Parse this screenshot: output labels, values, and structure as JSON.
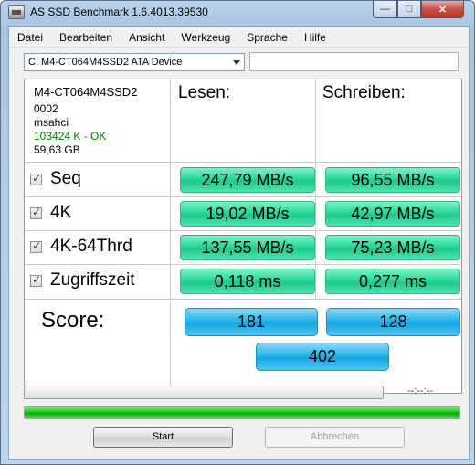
{
  "window": {
    "title": "AS SSD Benchmark 1.6.4013.39530"
  },
  "menu": [
    "Datei",
    "Bearbeiten",
    "Ansicht",
    "Werkzeug",
    "Sprache",
    "Hilfe"
  ],
  "drive_select": {
    "value": "C: M4-CT064M4SSD2 ATA Device"
  },
  "device_info": {
    "name": "M4-CT064M4SSD2",
    "firmware": "0002",
    "driver": "msahci",
    "alignment": "103424 K - OK",
    "size": "59,63 GB"
  },
  "columns": {
    "read": "Lesen:",
    "write": "Schreiben:"
  },
  "rows": [
    {
      "label": "Seq",
      "read": "247,79 MB/s",
      "write": "96,55 MB/s"
    },
    {
      "label": "4K",
      "read": "19,02 MB/s",
      "write": "42,97 MB/s"
    },
    {
      "label": "4K-64Thrd",
      "read": "137,55 MB/s",
      "write": "75,23 MB/s"
    },
    {
      "label": "Zugriffszeit",
      "read": "0,118 ms",
      "write": "0,277 ms"
    }
  ],
  "score": {
    "label": "Score:",
    "read": "181",
    "write": "128",
    "total": "402"
  },
  "progress": {
    "time": "--:--:--",
    "overall_fraction": 1.0
  },
  "buttons": {
    "start": "Start",
    "cancel": "Abbrechen"
  },
  "colors": {
    "result_green": "#27d89a",
    "score_blue": "#26b4ea",
    "ok_text": "#008000"
  }
}
